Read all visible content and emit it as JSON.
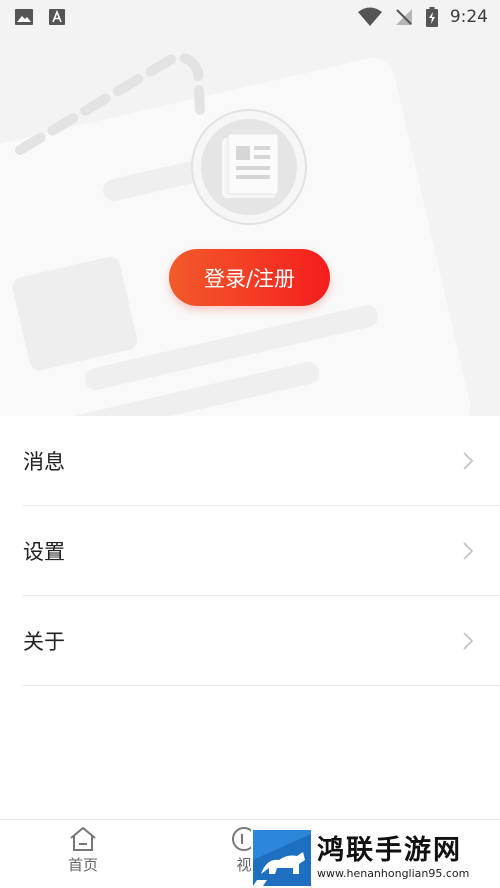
{
  "status_bar": {
    "time": "9:24",
    "icons": [
      "image-notification-icon",
      "font-a-notification-icon",
      "wifi-icon",
      "no-signal-icon",
      "battery-charging-icon"
    ]
  },
  "header": {
    "avatar_icon": "document-icon",
    "login_button_label": "登录/注册"
  },
  "menu": {
    "items": [
      {
        "label": "消息",
        "icon": "chevron-right-icon"
      },
      {
        "label": "设置",
        "icon": "chevron-right-icon"
      },
      {
        "label": "关于",
        "icon": "chevron-right-icon"
      }
    ]
  },
  "tabbar": {
    "tabs": [
      {
        "label": "首页",
        "icon": "home-icon"
      },
      {
        "label": "视",
        "icon": "video-icon"
      }
    ]
  },
  "watermark": {
    "title": "鸿联手游网",
    "url": "www.henanhonglian95.com"
  },
  "colors": {
    "accent_start": "#f25a2a",
    "accent_end": "#f41d1d",
    "header_bg": "#f3f3f3",
    "watermark_blue": "#1f6fc1"
  }
}
